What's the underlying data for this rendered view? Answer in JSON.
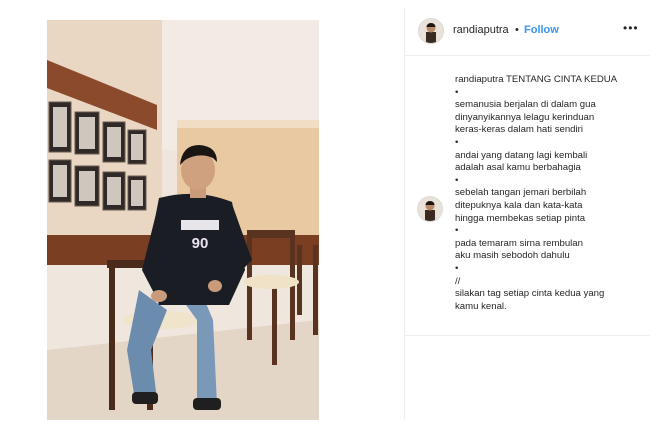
{
  "post": {
    "username": "randiaputra",
    "separator": "•",
    "follow_label": "Follow",
    "more_label": "•••",
    "photo": {
      "shirt_text": "GENERASI 90"
    },
    "caption": {
      "author": "randiaputra",
      "lines": [
        "TENTANG CINTA KEDUA",
        "•",
        "semanusia berjalan di dalam gua",
        "dinyanyikannya lelagu kerinduan",
        "keras-keras dalam hati sendiri",
        "•",
        "andai yang datang lagi kembali",
        "adalah asal kamu berbahagia",
        "•",
        "sebelah tangan jemari berbilah",
        "ditepuknya kala dan kata-kata",
        "hingga membekas setiap pinta",
        "•",
        "pada temaram sirna rembulan",
        "aku masih sebodoh dahulu",
        "•",
        "//",
        "silakan tag setiap cinta kedua yang",
        "kamu kenal."
      ]
    }
  },
  "colors": {
    "link": "#3897f0",
    "text": "#262626",
    "border": "#efefef"
  }
}
